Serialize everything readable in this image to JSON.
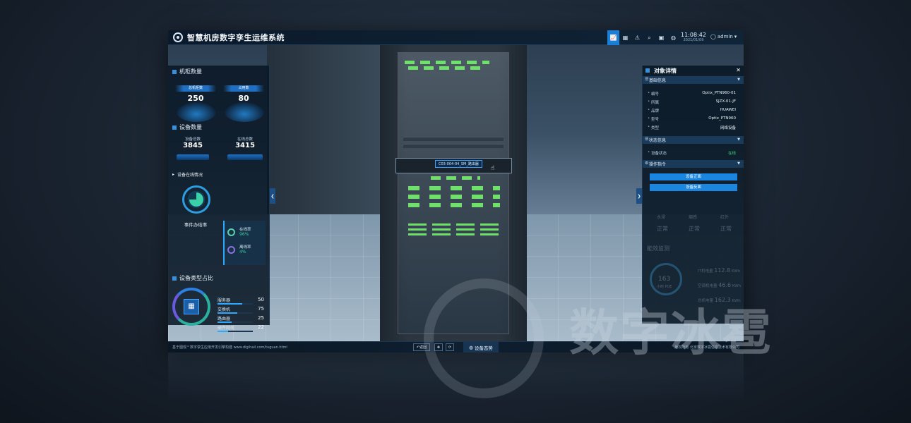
{
  "header": {
    "title": "智慧机房数字孪生运维系统",
    "time": "11:08:42",
    "date": "2021/01/09",
    "user": "admin",
    "icons": [
      "chart-icon",
      "grid-icon",
      "alert-icon",
      "search-icon",
      "monitor-icon",
      "globe-icon"
    ]
  },
  "left": {
    "cabinet_title": "机柜数量",
    "cabinet_total_label": "总机柜数",
    "cabinet_total": "250",
    "cabinet_used_label": "占用数",
    "cabinet_used": "80",
    "device_title": "设备数量",
    "device_total_label": "设备总数",
    "device_total": "3845",
    "device_online_label": "在线总数",
    "device_online": "3415",
    "online_status_title": "设备在线情况",
    "event_label": "事件办结率",
    "online_rate_label": "在线率",
    "online_rate": "96%",
    "offline_rate_label": "离线率",
    "offline_rate": "4%",
    "type_title": "设备类型占比",
    "types": [
      {
        "name": "服务器",
        "value": "50",
        "pct": 0.7
      },
      {
        "name": "交换机",
        "value": "75",
        "pct": 0.55
      },
      {
        "name": "路由器",
        "value": "25",
        "pct": 0.4
      },
      {
        "name": "硬件网关",
        "value": "22",
        "pct": 0.3
      }
    ]
  },
  "scene": {
    "device_tag": "C03-004-04_SM_路由器"
  },
  "right": {
    "title": "对象详情",
    "basic_title": "基础信息",
    "basic": [
      {
        "k": "编号",
        "v": "Optix_PTN960-01"
      },
      {
        "k": "所属",
        "v": "SJZX-01-JF"
      },
      {
        "k": "品牌",
        "v": "HUAWEI"
      },
      {
        "k": "型号",
        "v": "Optix_PTN960"
      },
      {
        "k": "类型",
        "v": "网络设备"
      }
    ],
    "status_title": "状态信息",
    "status_key": "设备状态",
    "status_val": "在线",
    "ops_title": "操作指令",
    "btn_front": "设备正面",
    "btn_back": "设备反面",
    "faded": {
      "env": [
        "水浸",
        "烟感",
        "红外"
      ],
      "env_state": [
        "正常",
        "正常",
        "正常"
      ],
      "energy_title": "能效监测",
      "pue_value": "163",
      "pue_label": "小时 PUE",
      "rows": [
        {
          "k": "IT机电量",
          "v": "112.8",
          "u": "KWh"
        },
        {
          "k": "空调机电量",
          "v": "46.6",
          "u": "KWh"
        },
        {
          "k": "总机电量",
          "v": "162.3",
          "u": "KWh"
        }
      ]
    }
  },
  "footer": {
    "left": "基于图观™数字孪生应用开发引擎构建 www.digihail.com/tuguan.html",
    "back_label": "返回",
    "main_label": "设备态势",
    "right": "版权所有 北京数字冰雹信息技术有限公司"
  },
  "watermark": "数字冰雹"
}
